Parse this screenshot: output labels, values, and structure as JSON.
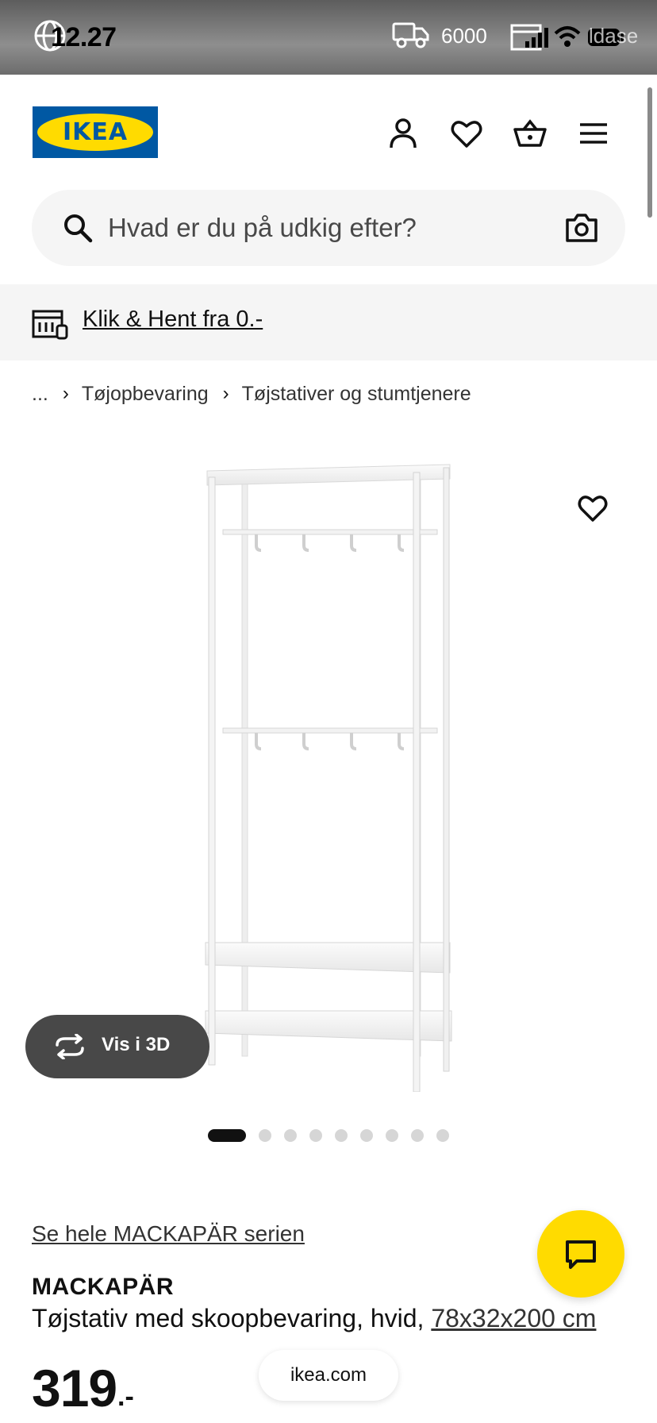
{
  "status_bar": {
    "time": "12.27",
    "delivery_value": "6000",
    "overlay_text": "ldase"
  },
  "header": {
    "logo_text": "IKEA",
    "icons": [
      "profile-icon",
      "favorites-icon",
      "cart-icon",
      "menu-icon"
    ]
  },
  "search": {
    "placeholder": "Hvad er du på udkig efter?"
  },
  "banner": {
    "link_text": "Klik & Hent fra 0.-"
  },
  "breadcrumb": {
    "items": [
      "...",
      "Tøjopbevaring",
      "Tøjstativer og stumtjenere"
    ]
  },
  "gallery": {
    "view3d_label": "Vis i 3D",
    "total_images": 9,
    "active_index": 0
  },
  "product": {
    "series_link": "Se hele MACKAPÄR serien",
    "name": "MACKAPÄR",
    "description": "Tøjstativ med skoopbevaring, hvid, ",
    "dimensions": "78x32x200 cm",
    "price": "319",
    "price_suffix": ".-"
  },
  "browser": {
    "url": "ikea.com"
  },
  "colors": {
    "ikea_blue": "#0058a3",
    "ikea_yellow": "#ffdb00",
    "light_gray": "#f5f5f5",
    "dark_gray": "#484848"
  }
}
